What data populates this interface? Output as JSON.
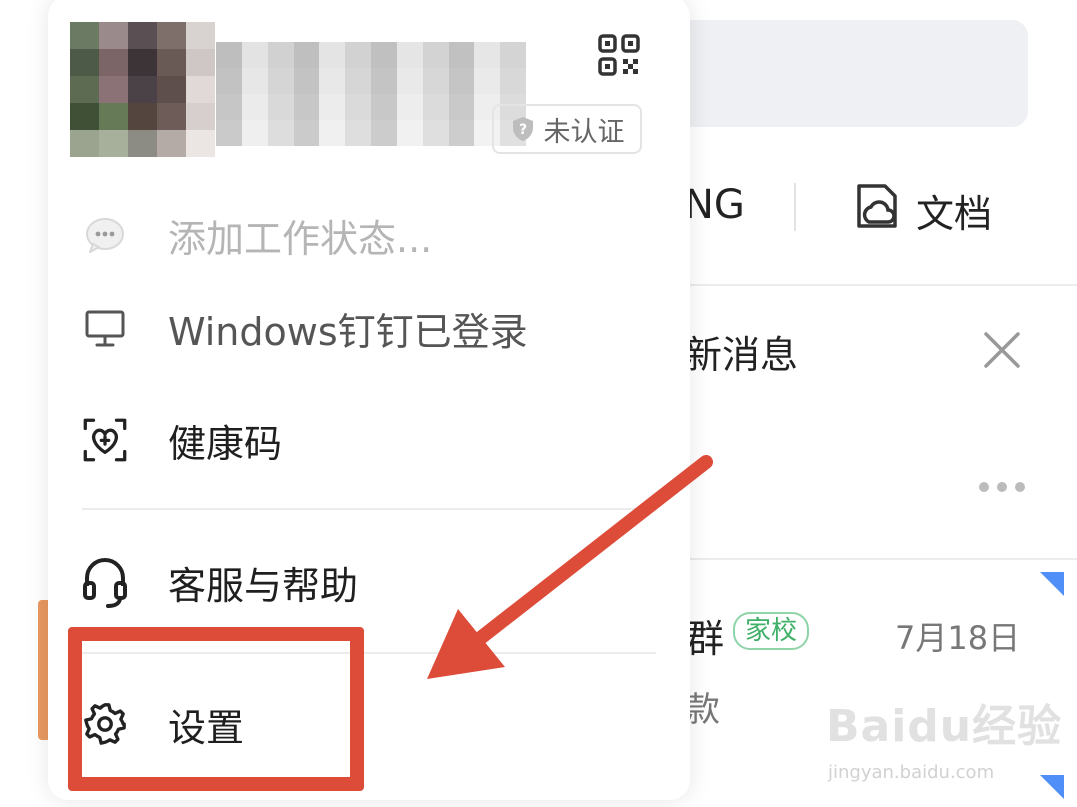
{
  "popup": {
    "verify_badge": "未认证",
    "menu": {
      "status_label": "添加工作状态...",
      "windows_label": "Windows钉钉已登录",
      "health_label": "健康码",
      "help_label": "客服与帮助",
      "settings_label": "设置"
    }
  },
  "background": {
    "tab_partial": "NG",
    "doc_tab_label": "文档",
    "news_partial": "新消息",
    "chat_name_partial": "群",
    "chat_tag": "家校",
    "chat_date": "7月18日",
    "chat_preview_partial": "款"
  },
  "annotation": {
    "highlight_color": "#dd4b39"
  },
  "watermark": {
    "logo": "Baidu经验",
    "url": "jingyan.baidu.com"
  }
}
